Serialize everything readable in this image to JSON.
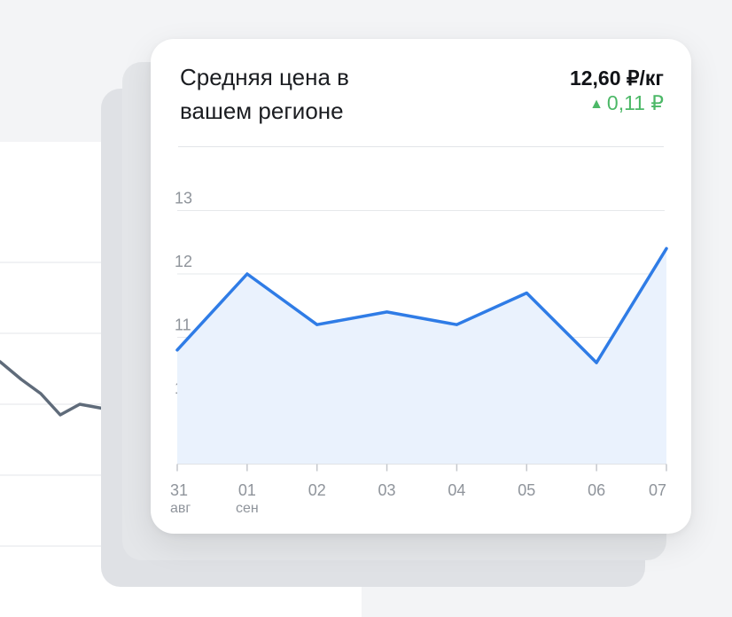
{
  "card": {
    "title": "Средняя цена в вашем регионе",
    "price": "12,60 ₽/кг",
    "delta": "0,11 ₽",
    "delta_direction": "up",
    "delta_color": "#4cb867"
  },
  "chart_data": {
    "type": "area",
    "title": "Средняя цена в вашем регионе",
    "x": [
      {
        "day": "31",
        "month": "авг"
      },
      {
        "day": "01",
        "month": "сен"
      },
      {
        "day": "02",
        "month": ""
      },
      {
        "day": "03",
        "month": ""
      },
      {
        "day": "04",
        "month": ""
      },
      {
        "day": "05",
        "month": ""
      },
      {
        "day": "06",
        "month": ""
      },
      {
        "day": "07",
        "month": ""
      }
    ],
    "series": [
      {
        "values": [
          10.8,
          12.0,
          11.2,
          11.4,
          11.2,
          11.7,
          10.6,
          12.4
        ],
        "color": "#2f7ce6",
        "fill": "#eaf2fd"
      }
    ],
    "yticks": [
      10,
      11,
      12,
      13
    ],
    "ylim": [
      9,
      13
    ],
    "grid": true
  },
  "background_chart": {
    "line_color": "#5f6b7a",
    "values": [
      11.6,
      11.35,
      11.15,
      10.85,
      11.0,
      10.95,
      10.9,
      10.65,
      11.25,
      11.2
    ]
  }
}
